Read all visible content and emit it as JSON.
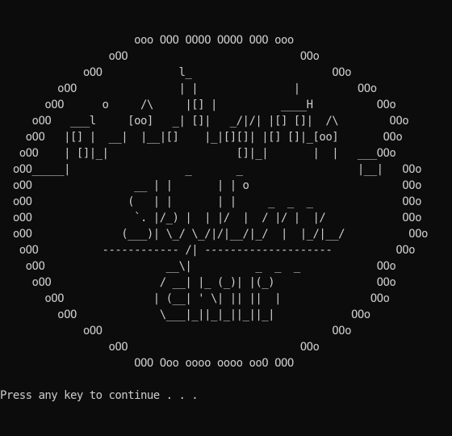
{
  "console": {
    "ascii_art": "                     ooo OOO OOOO OOOO OOO ooo\n                 oOO                           OOo\n             oOO            l_                      OOo\n         oOO                | |               |         OOo\n       oOO      o     /\\     |[] |          ____H          OOo\n     oOO   ___l     [oo]   _| []|   _/|/| |[] []|  /\\        OOo\n    oOO   |[] |  __|  |__|[]    |_|[][]| |[] []|_[oo]       OOo\n   oOO    | []|_|                    []|_|       |  |   ___OOo\n  oOO_____|                  _       _                  |__|   OOo\n  oOO                __ | |       | | o                        OOo\n  oOO               (   | |       | |     _  _  _              OOo\n  oOO                `. |/_) |  | |/  |  / |/ |  |/            OOo\n  oOO              (___)| \\_/ \\_/|/|__/|_/  |  |_/|__/          OOo\n   oOO          ------------ /| --------------------          OOo\n    oOO                   __\\|          _  _  _            OOo\n     oOO                 / __| |_ (_)| |(_)                OOo\n       oOO              | (__| ' \\| || ||  |              OOo\n         oOO             \\___|_||_|_||_||_|            OOo\n             oOO                                    OOo\n                 oOO                           OOo\n                     OOO Ooo oooo oooo ooO OOO",
    "prompt": "Press any key to continue . . ."
  }
}
